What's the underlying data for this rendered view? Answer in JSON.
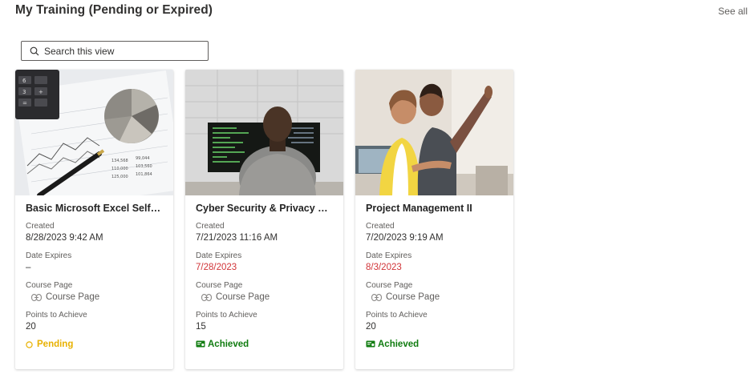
{
  "header": {
    "title": "My Training (Pending or Expired)",
    "see_all": "See all"
  },
  "search": {
    "placeholder": "Search this view"
  },
  "labels": {
    "created": "Created",
    "date_expires": "Date Expires",
    "course_page": "Course Page",
    "points": "Points to Achieve"
  },
  "colors": {
    "expired_red": "#d13438",
    "pending_yellow": "#e8b100",
    "achieved_green": "#107c10"
  },
  "cards": [
    {
      "title": "Basic Microsoft Excel Self-pac...",
      "created": "8/28/2023 9:42 AM",
      "expires": "–",
      "course_link": "Course Page",
      "points": "20",
      "status": "Pending",
      "status_icon": "circle-icon"
    },
    {
      "title": "Cyber Security & Privacy Essen...",
      "created": "7/21/2023 11:16 AM",
      "expires": "7/28/2023",
      "course_link": "Course Page",
      "points": "15",
      "status": "Achieved",
      "status_icon": "certificate-icon"
    },
    {
      "title": "Project Management II",
      "created": "7/20/2023 9:19 AM",
      "expires": "8/3/2023",
      "course_link": "Course Page",
      "points": "20",
      "status": "Achieved",
      "status_icon": "certificate-icon"
    }
  ]
}
